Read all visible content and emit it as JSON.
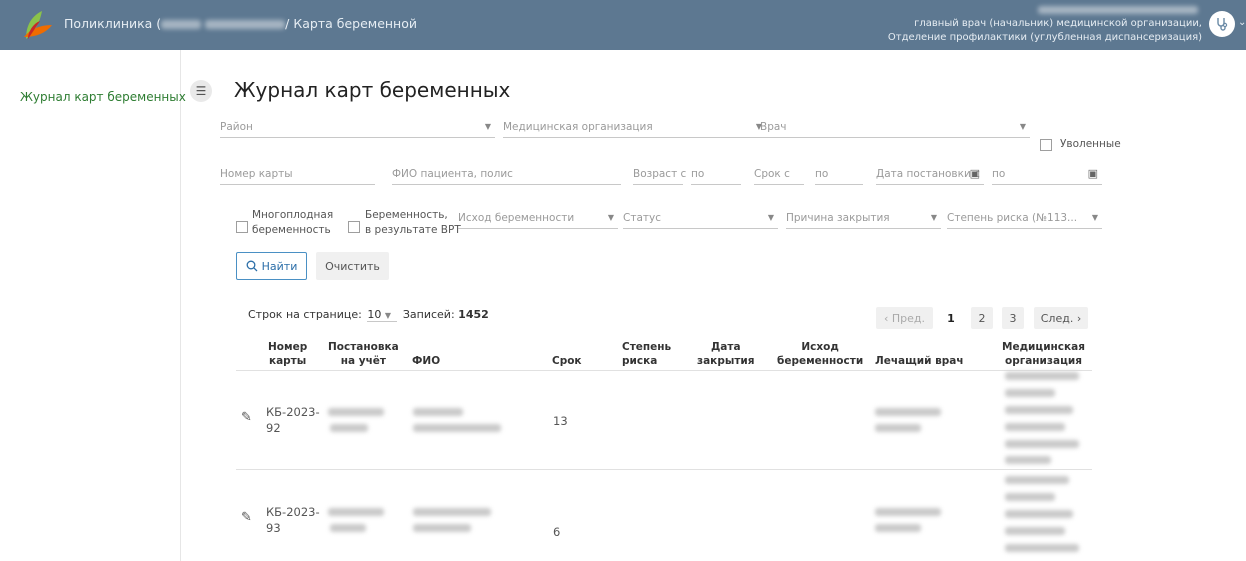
{
  "header": {
    "app_title": "Поликлиника (",
    "breadcrumb_suffix": "/ Карта беременной",
    "user_role": "главный врач (начальник) медицинской организации, Отделение профилактики (углубленная диспансеризация)"
  },
  "sidebar": {
    "items": [
      {
        "label": "Журнал карт беременных"
      }
    ]
  },
  "page": {
    "title": "Журнал карт беременных"
  },
  "filters": {
    "district": "Район",
    "org": "Медицинская организация",
    "doctor": "Врач",
    "fired_label": "Уволенные",
    "card_number": "Номер карты",
    "patient": "ФИО пациента, полис",
    "age_from": "Возраст с",
    "age_to": "по",
    "term_from": "Срок с",
    "term_to": "по",
    "reg_date_from": "Дата постановки с",
    "reg_date_to": "по",
    "multiple_line1": "Многоплодная",
    "multiple_line2": "беременность",
    "ivf_line1": "Беременность,",
    "ivf_line2": "в результате ВРТ",
    "outcome": "Исход беременности",
    "status": "Статус",
    "close_reason": "Причина закрытия",
    "risk": "Степень риска (№113..."
  },
  "actions": {
    "find": "Найти",
    "clear": "Очистить"
  },
  "table_meta": {
    "rows_per_page_label": "Строк на странице:",
    "rows_per_page_value": "10",
    "records_label": "Записей:",
    "records_value": "1452"
  },
  "pagination": {
    "prev": "‹ Пред.",
    "pages": [
      "1",
      "2",
      "3"
    ],
    "next": "След. ›"
  },
  "table": {
    "columns": {
      "card_no_1": "Номер",
      "card_no_2": "карты",
      "reg_1": "Постановка",
      "reg_2": "на учёт",
      "fio": "ФИО",
      "term": "Срок",
      "risk_1": "Степень",
      "risk_2": "риска",
      "close_1": "Дата",
      "close_2": "закрытия",
      "outcome_1": "Исход",
      "outcome_2": "беременности",
      "doctor": "Лечащий врач",
      "org_1": "Медицинская",
      "org_2": "организация"
    },
    "rows": [
      {
        "card_1": "КБ-2023-",
        "card_2": "92",
        "term": "13"
      },
      {
        "card_1": "КБ-2023-",
        "card_2": "93",
        "term": "6"
      }
    ]
  },
  "icons": {
    "logo": "logo-icon",
    "avatar": "stethoscope-icon",
    "menu": "hamburger-icon",
    "search": "search-icon",
    "edit": "pencil-icon",
    "calendar": "calendar-icon",
    "dropdown": "chevron-down-icon"
  },
  "colors": {
    "header_bg": "#5d7891",
    "sidebar_active": "#2e7d32",
    "primary_button": "#4a90c4"
  }
}
